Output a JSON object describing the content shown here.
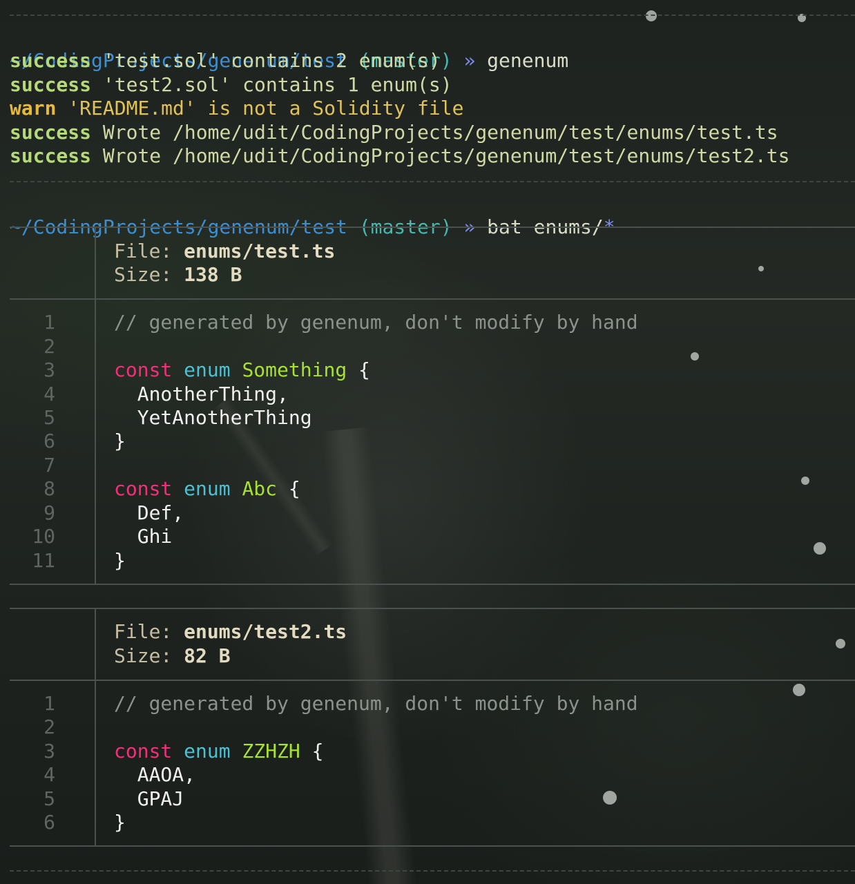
{
  "prompt1": {
    "path": "~/CodingProjects/genenum/test",
    "branch": "(master)",
    "arrow": "»",
    "command": "genenum"
  },
  "output": [
    {
      "level": "success",
      "text": "'test.sol' contains 2 enum(s)"
    },
    {
      "level": "success",
      "text": "'test2.sol' contains 1 enum(s)"
    },
    {
      "level": "warn",
      "text": "'README.md' is not a Solidity file"
    },
    {
      "level": "success",
      "text": "Wrote /home/udit/CodingProjects/genenum/test/enums/test.ts"
    },
    {
      "level": "success",
      "text": "Wrote /home/udit/CodingProjects/genenum/test/enums/test2.ts"
    }
  ],
  "prompt2": {
    "path": "~/CodingProjects/genenum/test",
    "branch": "(master)",
    "arrow": "»",
    "command": "bat enums/",
    "glob": "*"
  },
  "files": [
    {
      "file_label": "File:",
      "file_name": "enums/test.ts",
      "size_label": "Size:",
      "size": "138 B",
      "lines": [
        {
          "n": "1",
          "comment": "// generated by genenum, don't modify by hand"
        },
        {
          "n": "2"
        },
        {
          "n": "3",
          "kw": "const",
          "type": "enum",
          "name": "Something",
          "brace": "{"
        },
        {
          "n": "4",
          "member": "AnotherThing,"
        },
        {
          "n": "5",
          "member": "YetAnotherThing"
        },
        {
          "n": "6",
          "close": "}"
        },
        {
          "n": "7"
        },
        {
          "n": "8",
          "kw": "const",
          "type": "enum",
          "name": "Abc",
          "brace": "{"
        },
        {
          "n": "9",
          "member": "Def,"
        },
        {
          "n": "10",
          "member": "Ghi"
        },
        {
          "n": "11",
          "close": "}"
        }
      ]
    },
    {
      "file_label": "File:",
      "file_name": "enums/test2.ts",
      "size_label": "Size:",
      "size": "82 B",
      "lines": [
        {
          "n": "1",
          "comment": "// generated by genenum, don't modify by hand"
        },
        {
          "n": "2"
        },
        {
          "n": "3",
          "kw": "const",
          "type": "enum",
          "name": "ZZHZH",
          "brace": "{"
        },
        {
          "n": "4",
          "member": "AAOA,"
        },
        {
          "n": "5",
          "member": "GPAJ"
        },
        {
          "n": "6",
          "close": "}"
        }
      ]
    }
  ],
  "colors": {
    "path": "#3d8fd1",
    "branch": "#48b7ae",
    "success": "#b6d97a",
    "warn": "#e5b83f",
    "keyword": "#f2307a",
    "type": "#4ec0d3",
    "name": "#a6e22e",
    "comment": "#8b928c"
  }
}
